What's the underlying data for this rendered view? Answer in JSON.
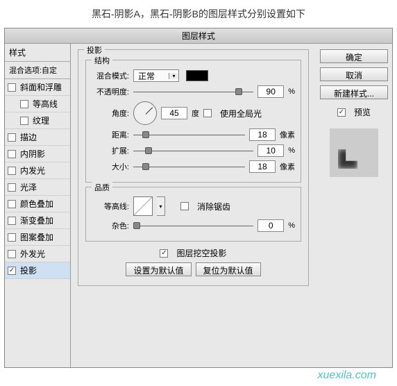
{
  "caption": "黑石-阴影A，黑石-阴影B的图层样式分别设置如下",
  "title": "图层样式",
  "sidebar": {
    "header": "样式",
    "subheader": "混合选项:自定",
    "items": [
      {
        "label": "斜面和浮雕",
        "checked": false,
        "indent": false
      },
      {
        "label": "等高线",
        "checked": false,
        "indent": true
      },
      {
        "label": "纹理",
        "checked": false,
        "indent": true
      },
      {
        "label": "描边",
        "checked": false,
        "indent": false
      },
      {
        "label": "内阴影",
        "checked": false,
        "indent": false
      },
      {
        "label": "内发光",
        "checked": false,
        "indent": false
      },
      {
        "label": "光泽",
        "checked": false,
        "indent": false
      },
      {
        "label": "颜色叠加",
        "checked": false,
        "indent": false
      },
      {
        "label": "渐变叠加",
        "checked": false,
        "indent": false
      },
      {
        "label": "图案叠加",
        "checked": false,
        "indent": false
      },
      {
        "label": "外发光",
        "checked": false,
        "indent": false
      },
      {
        "label": "投影",
        "checked": true,
        "indent": false,
        "selected": true
      }
    ]
  },
  "panel": {
    "title": "投影",
    "structure": {
      "legend": "结构",
      "blend_label": "混合模式:",
      "blend_value": "正常",
      "opacity_label": "不透明度:",
      "opacity_value": "90",
      "opacity_unit": "%",
      "angle_label": "角度:",
      "angle_value": "45",
      "angle_unit": "度",
      "global_light": "使用全局光",
      "global_checked": false,
      "distance_label": "距离:",
      "distance_value": "18",
      "distance_unit": "像素",
      "spread_label": "扩展:",
      "spread_value": "10",
      "spread_unit": "%",
      "size_label": "大小:",
      "size_value": "18",
      "size_unit": "像素"
    },
    "quality": {
      "legend": "品质",
      "contour_label": "等高线:",
      "antialias": "消除锯齿",
      "antialias_checked": false,
      "noise_label": "杂色:",
      "noise_value": "0",
      "noise_unit": "%"
    },
    "knockout": "图层挖空投影",
    "knockout_checked": true,
    "btn_default": "设置为默认值",
    "btn_reset": "复位为默认值"
  },
  "right": {
    "ok": "确定",
    "cancel": "取消",
    "new_style": "新建样式...",
    "preview": "预览",
    "preview_checked": true
  },
  "watermark": "xuexila.com"
}
